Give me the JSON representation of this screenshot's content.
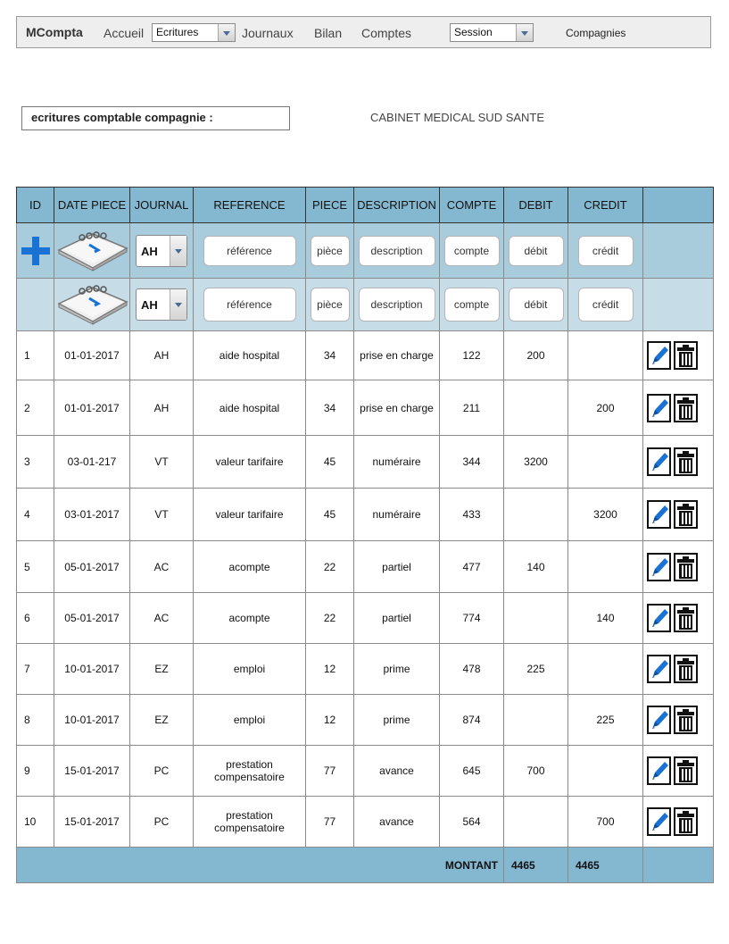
{
  "nav": {
    "brand": "MCompta",
    "accueil": "Accueil",
    "ecritures_select": "Ecritures",
    "journaux": "Journaux",
    "bilan": "Bilan",
    "comptes": "Comptes",
    "session_select": "Session",
    "compagnies": "Compagnies"
  },
  "company": {
    "label": "ecritures comptable compagnie :",
    "name": "CABINET MEDICAL SUD SANTE"
  },
  "table": {
    "headers": [
      "ID",
      "DATE PIECE",
      "JOURNAL",
      "REFERENCE",
      "PIECE",
      "DESCRIPTION",
      "COMPTE",
      "DEBIT",
      "CREDIT",
      ""
    ],
    "input_rows": [
      {
        "journal": "AH",
        "reference": "référence",
        "piece": "pièce",
        "description": "description",
        "compte": "compte",
        "debit": "débit",
        "credit": "crédit"
      },
      {
        "journal": "AH",
        "reference": "référence",
        "piece": "pièce",
        "description": "description",
        "compte": "compte",
        "debit": "débit",
        "credit": "crédit"
      }
    ],
    "rows": [
      {
        "id": "1",
        "date": "01-01-2017",
        "journal": "AH",
        "reference": "aide hospital",
        "piece": "34",
        "description": "prise en charge",
        "compte": "122",
        "debit": "200",
        "credit": ""
      },
      {
        "id": "2",
        "date": "01-01-2017",
        "journal": "AH",
        "reference": "aide hospital",
        "piece": "34",
        "description": "prise en charge",
        "compte": "211",
        "debit": "",
        "credit": "200"
      },
      {
        "id": "3",
        "date": "03-01-217",
        "journal": "VT",
        "reference": "valeur tarifaire",
        "piece": "45",
        "description": "numéraire",
        "compte": "344",
        "debit": "3200",
        "credit": ""
      },
      {
        "id": "4",
        "date": "03-01-2017",
        "journal": "VT",
        "reference": "valeur tarifaire",
        "piece": "45",
        "description": "numéraire",
        "compte": "433",
        "debit": "",
        "credit": "3200"
      },
      {
        "id": "5",
        "date": "05-01-2017",
        "journal": "AC",
        "reference": "acompte",
        "piece": "22",
        "description": "partiel",
        "compte": "477",
        "debit": "140",
        "credit": ""
      },
      {
        "id": "6",
        "date": "05-01-2017",
        "journal": "AC",
        "reference": "acompte",
        "piece": "22",
        "description": "partiel",
        "compte": "774",
        "debit": "",
        "credit": "140"
      },
      {
        "id": "7",
        "date": "10-01-2017",
        "journal": "EZ",
        "reference": "emploi",
        "piece": "12",
        "description": "prime",
        "compte": "478",
        "debit": "225",
        "credit": ""
      },
      {
        "id": "8",
        "date": "10-01-2017",
        "journal": "EZ",
        "reference": "emploi",
        "piece": "12",
        "description": "prime",
        "compte": "874",
        "debit": "",
        "credit": "225"
      },
      {
        "id": "9",
        "date": "15-01-2017",
        "journal": "PC",
        "reference": "prestation compensatoire",
        "piece": "77",
        "description": "avance",
        "compte": "645",
        "debit": "700",
        "credit": ""
      },
      {
        "id": "10",
        "date": "15-01-2017",
        "journal": "PC",
        "reference": "prestation compensatoire",
        "piece": "77",
        "description": "avance",
        "compte": "564",
        "debit": "",
        "credit": "700"
      }
    ],
    "total": {
      "label": "MONTANT",
      "debit": "4465",
      "credit": "4465"
    }
  },
  "icons": {
    "add": "plus-icon",
    "date": "calendar-icon",
    "edit": "pencil-icon",
    "delete": "trash-icon"
  },
  "colors": {
    "header_bg": "#84b8d0",
    "input_row_bg": "#a8ccdc",
    "input_row2_bg": "#c6dde7",
    "accent_blue": "#1a73d4",
    "nav_bg": "#eeeeee"
  }
}
